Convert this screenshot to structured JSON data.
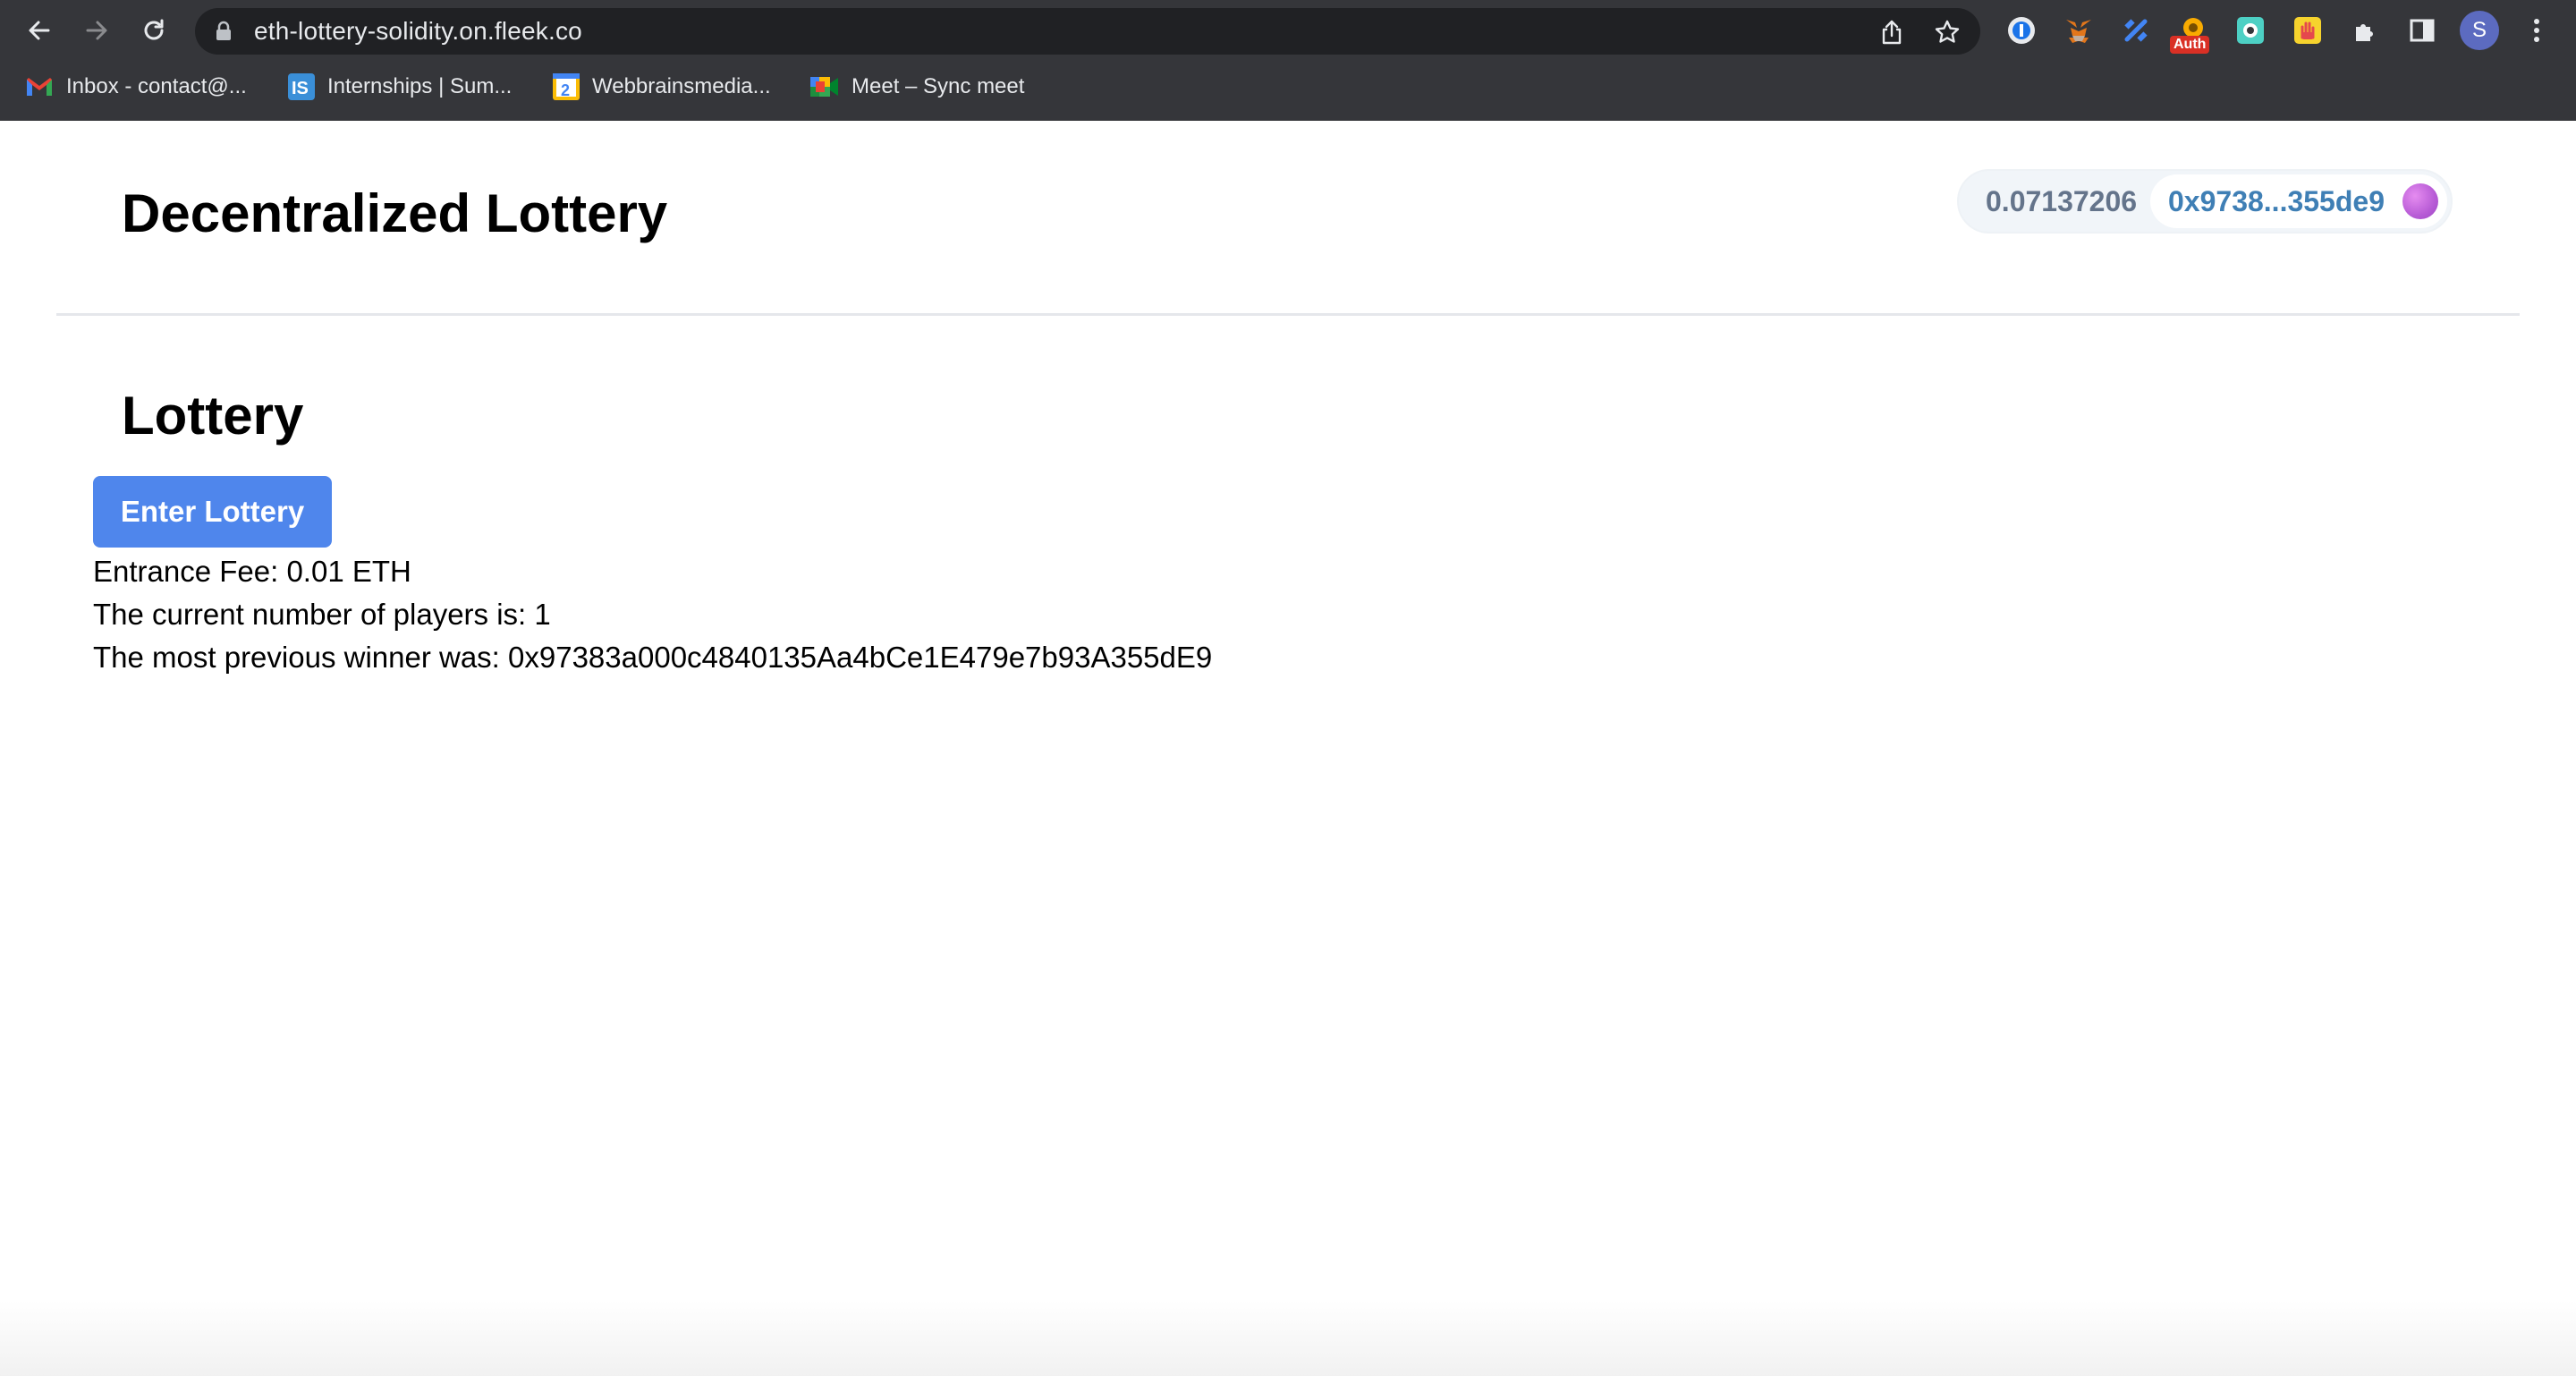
{
  "browser": {
    "url": "eth-lottery-solidity.on.fleek.co",
    "profile_initial": "S",
    "extension_badge": "Auth",
    "bookmarks": [
      {
        "label": "Inbox - contact@...",
        "icon": "gmail-icon"
      },
      {
        "label": "Internships | Sum...",
        "icon": "internshala-icon"
      },
      {
        "label": "Webbrainsmedia...",
        "icon": "calendar-icon"
      },
      {
        "label": "Meet – Sync meet",
        "icon": "google-meet-icon"
      }
    ]
  },
  "header": {
    "title": "Decentralized Lottery",
    "wallet": {
      "balance": "0.07137206",
      "address": "0x9738...355de9"
    }
  },
  "lottery": {
    "heading": "Lottery",
    "enter_button": "Enter Lottery",
    "entrance_fee": "Entrance Fee: 0.01 ETH",
    "players": "The current number of players is: 1",
    "previous_winner": "The most previous winner was: 0x97383a000c4840135Aa4bCe1E479e7b93A355dE9"
  },
  "colors": {
    "accent": "#4f86ec",
    "wallet_address": "#3f7fb5",
    "wallet_balance": "#64748b",
    "chrome_bg": "#35363a"
  }
}
